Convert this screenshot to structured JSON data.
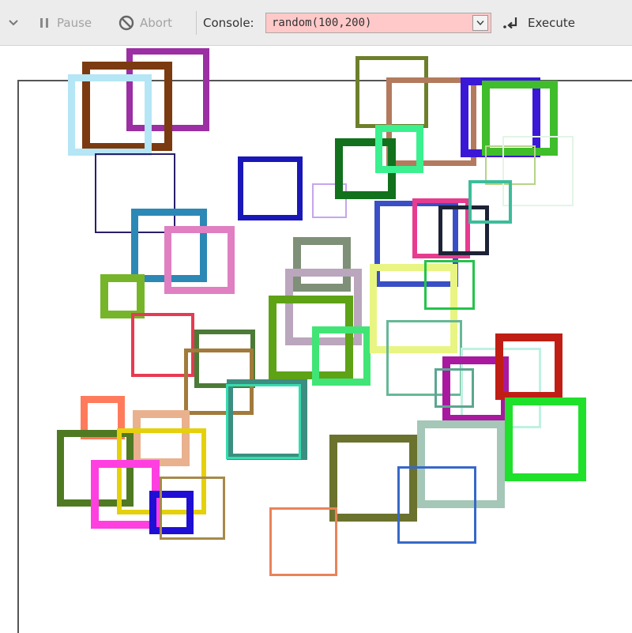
{
  "toolbar": {
    "pause_label": "Pause",
    "abort_label": "Abort",
    "console_label": "Console:",
    "console_value": "random(100,200)",
    "execute_label": "Execute"
  },
  "colors": {
    "console_bg": "#ffc9c9",
    "toolbar_bg": "#ececec"
  },
  "icons": {
    "collapse": "chevron-down-icon",
    "pause": "pause-icon",
    "abort": "prohibit-icon",
    "dropdown": "dropdown-arrow-icon",
    "execute": "execute-icon"
  },
  "squares": [
    {
      "color": "#9b2fa3"
    },
    {
      "color": "#7b3a10"
    },
    {
      "color": "#b4e6f5"
    },
    {
      "color": "#2a1f6a"
    },
    {
      "color": "#2c88b5"
    },
    {
      "color": "#e07fc2"
    },
    {
      "color": "#1a17b8"
    },
    {
      "color": "#c6a5ee"
    },
    {
      "color": "#76b52a"
    },
    {
      "color": "#e63b52"
    },
    {
      "color": "#6d7f2b"
    },
    {
      "color": "#b37a5e"
    },
    {
      "color": "#3b18d6"
    },
    {
      "color": "#3fbd2b"
    },
    {
      "color": "#b5d588"
    },
    {
      "color": "#e3f4e6"
    },
    {
      "color": "#11711c"
    },
    {
      "color": "#3af08f"
    },
    {
      "color": "#3a4fc6"
    },
    {
      "color": "#e73b8f"
    },
    {
      "color": "#1e2236"
    },
    {
      "color": "#3dbd9a"
    },
    {
      "color": "#7e9077"
    },
    {
      "color": "#baa6bd"
    },
    {
      "color": "#5ea216"
    },
    {
      "color": "#40e575"
    },
    {
      "color": "#e8f582"
    },
    {
      "color": "#66b897"
    },
    {
      "color": "#24c44b"
    },
    {
      "color": "#bff1e1"
    },
    {
      "color": "#a8199f"
    },
    {
      "color": "#5ca690"
    },
    {
      "color": "#c01e14"
    },
    {
      "color": "#4c7a37"
    },
    {
      "color": "#a27a3b"
    },
    {
      "color": "#3b8e80"
    },
    {
      "color": "#34dcae"
    },
    {
      "color": "#ff7b5c"
    },
    {
      "color": "#e9b18e"
    },
    {
      "color": "#4f7a22"
    },
    {
      "color": "#e4d10c"
    },
    {
      "color": "#ff3fe0"
    },
    {
      "color": "#1f0ed4"
    },
    {
      "color": "#a8894a"
    },
    {
      "color": "#6b722e"
    },
    {
      "color": "#a4c7b7"
    },
    {
      "color": "#3768c8"
    },
    {
      "color": "#e9835a"
    },
    {
      "color": "#1fe02a"
    }
  ]
}
